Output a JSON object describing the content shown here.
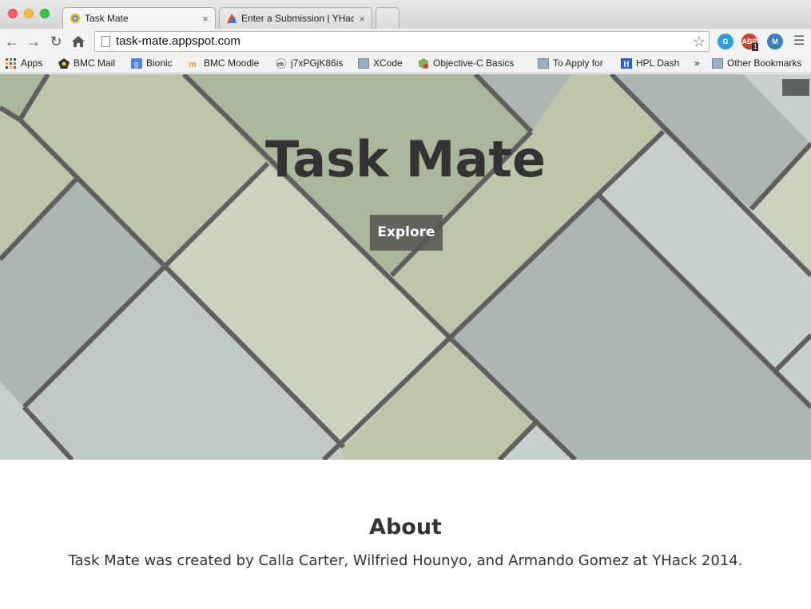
{
  "browser": {
    "tabs": [
      {
        "title": "Task Mate",
        "close": "×"
      },
      {
        "title": "Enter a Submission | YHack",
        "close": "×"
      }
    ],
    "url": "task-mate.appspot.com",
    "extensions": {
      "abp_label": "ABP",
      "abp_badge": "1",
      "m_label": "M"
    },
    "bookmarks": [
      {
        "label": "Apps",
        "icon": "apps-grid-icon"
      },
      {
        "label": "BMC Mail",
        "icon": "bmc-mail-icon"
      },
      {
        "label": "Bionic",
        "icon": "google-icon"
      },
      {
        "label": "BMC Moodle",
        "icon": "moodle-icon"
      },
      {
        "label": "j7xPGjK86is",
        "icon": "cb-icon"
      },
      {
        "label": "XCode",
        "icon": "folder-icon"
      },
      {
        "label": "Objective-C Basics",
        "icon": "objc-icon"
      },
      {
        "label": "To Apply for",
        "icon": "folder-icon"
      },
      {
        "label": "HPL Dash",
        "icon": "hpl-icon"
      }
    ],
    "overflow": "»",
    "other_bookmarks": "Other Bookmarks"
  },
  "hero": {
    "title": "Task Mate",
    "explore_label": "Explore"
  },
  "about": {
    "heading": "About",
    "text": "Task Mate was created by Calla Carter, Wilfried Hounyo, and Armando Gomez at YHack 2014."
  },
  "colors": {
    "tile_olive": "#abb79a",
    "tile_sage": "#bec6aa",
    "tile_light": "#cbd2bd",
    "tile_gray": "#adb7b2",
    "tile_pale": "#c8d0cc",
    "grout": "#5f5f5f"
  }
}
